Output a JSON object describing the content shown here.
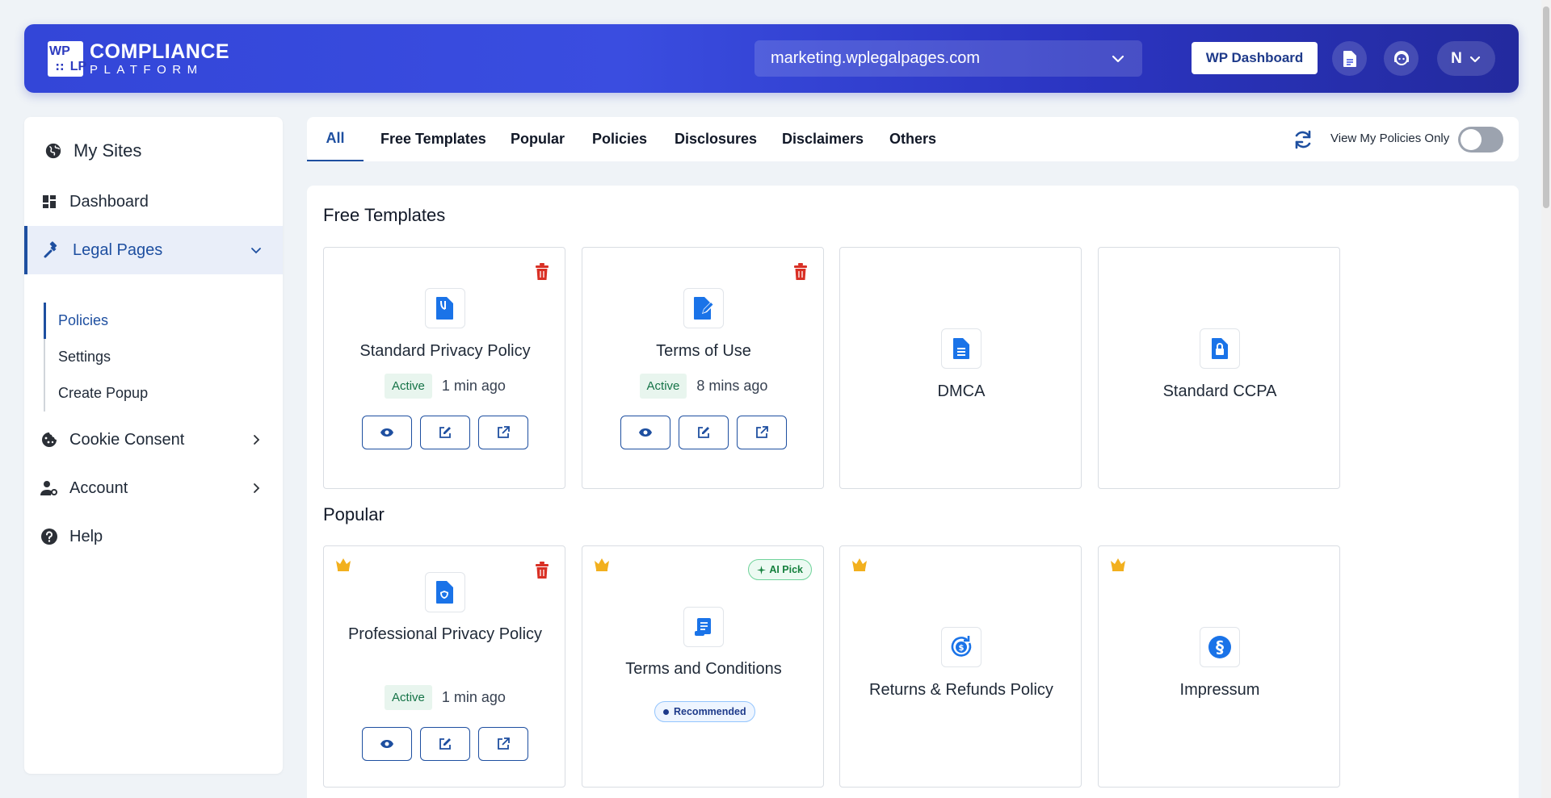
{
  "header": {
    "logo_mark": [
      "WP",
      "",
      "",
      "LP"
    ],
    "logo_line1": "COMPLIANCE",
    "logo_line2": "PLATFORM",
    "site": "marketing.wplegalpages.com",
    "wp_dashboard": "WP Dashboard",
    "user_initial": "N"
  },
  "sidebar": {
    "my_sites": "My Sites",
    "dashboard": "Dashboard",
    "legal_pages": "Legal Pages",
    "sub": [
      "Policies",
      "Settings",
      "Create Popup"
    ],
    "cookie_consent": "Cookie Consent",
    "account": "Account",
    "help": "Help"
  },
  "tabs": [
    "All",
    "Free Templates",
    "Popular",
    "Policies",
    "Disclosures",
    "Disclaimers",
    "Others"
  ],
  "toolbar": {
    "view_my_policies": "View My Policies Only"
  },
  "sections": {
    "free_templates": {
      "title": "Free Templates",
      "cards": [
        {
          "title": "Standard Privacy Policy",
          "status": "Active",
          "time": "1 min ago"
        },
        {
          "title": "Terms of Use",
          "status": "Active",
          "time": "8 mins ago"
        },
        {
          "title": "DMCA"
        },
        {
          "title": "Standard CCPA"
        }
      ]
    },
    "popular": {
      "title": "Popular",
      "cards": [
        {
          "title": "Professional Privacy Policy",
          "status": "Active",
          "time": "1 min ago"
        },
        {
          "title": "Terms and Conditions",
          "badge_top": "AI Pick",
          "badge": "Recommended"
        },
        {
          "title": "Returns & Refunds Policy"
        },
        {
          "title": "Impressum"
        }
      ]
    }
  },
  "colors": {
    "accent": "#1e4fa0",
    "icon_blue": "#1a73e8",
    "danger": "#d93025",
    "crown": "#f2b01e"
  }
}
